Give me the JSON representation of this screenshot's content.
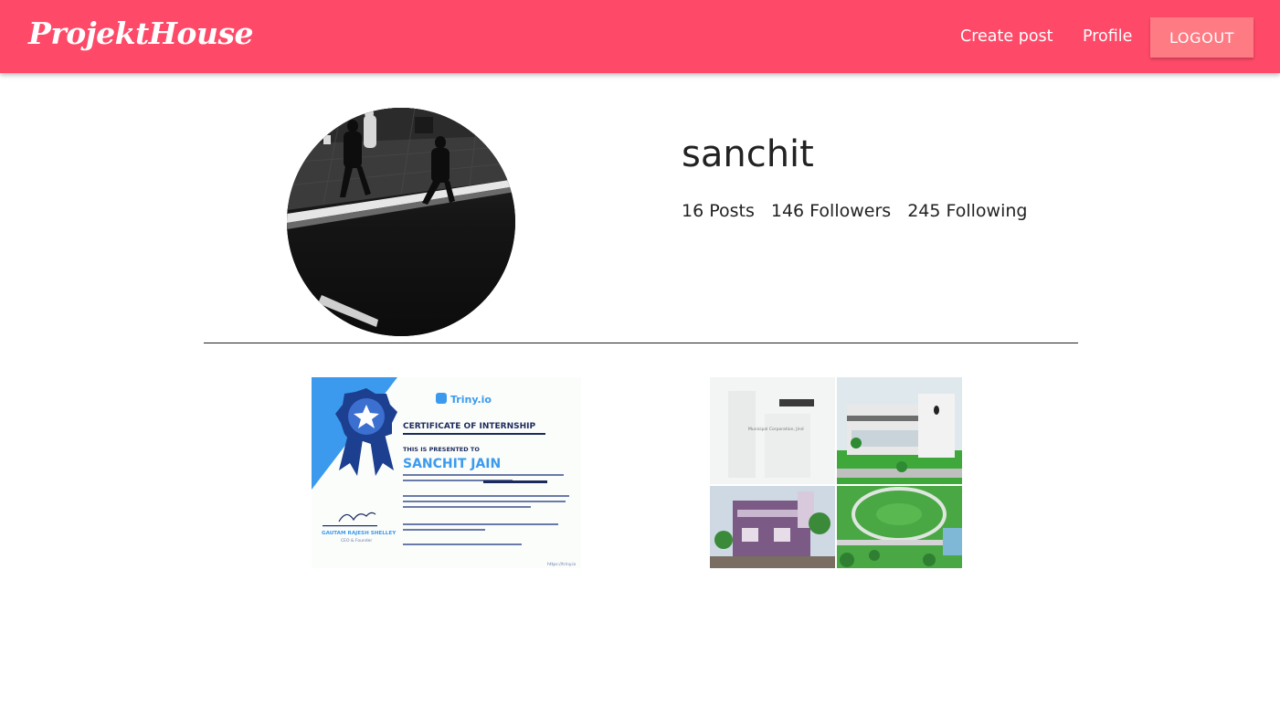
{
  "navbar": {
    "brand": "ProjektHouse",
    "links": [
      "Create post",
      "Profile"
    ],
    "logout_label": "LOGOUT",
    "bg_color": "#fe4a68"
  },
  "profile": {
    "username": "sanchit",
    "stats": {
      "posts": "16 Posts",
      "followers": "146 Followers",
      "following": "245 Following"
    }
  },
  "posts": {
    "certificate": {
      "brand": "Triny.io",
      "title": "CERTIFICATE OF INTERNSHIP",
      "presented": "THIS IS PRESENTED TO",
      "name": "SANCHIT JAIN",
      "signer": "GAUTAM RAJESH SHELLEY",
      "signer_role": "CEO & Founder",
      "url": "https://triny.io"
    },
    "architecture": {
      "label": "Municipal Corporation, Jind"
    }
  }
}
